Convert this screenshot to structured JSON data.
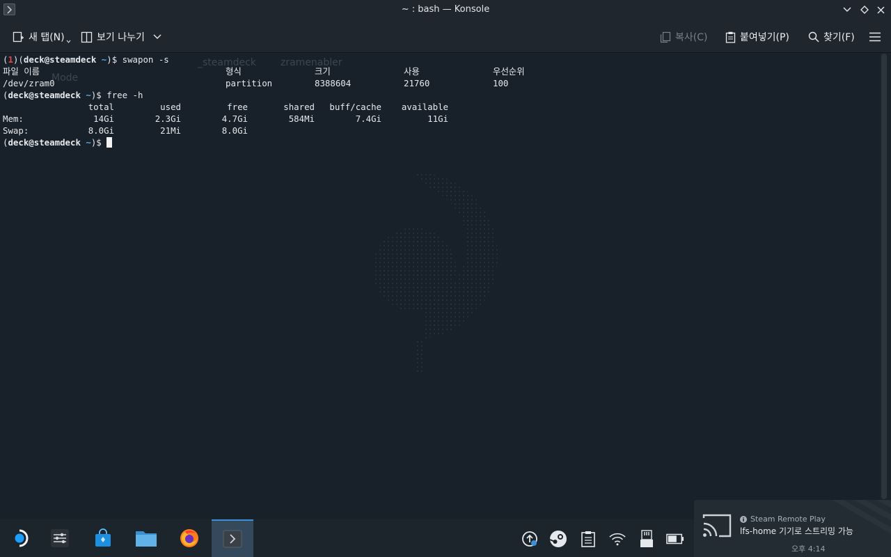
{
  "window": {
    "title": "~ : bash — Konsole"
  },
  "toolbar": {
    "new_tab": "새 탭(N)",
    "split_view": "보기 나누기",
    "copy": "복사(C)",
    "paste": "붙여넣기(P)",
    "find": "찾기(F)"
  },
  "terminal": {
    "ghost_texts": [
      "_steamdeck",
      "zramenabler",
      "Mode"
    ],
    "prompt_user": "deck@steamdeck",
    "prompt_dir": "~",
    "prev_status": "1",
    "cmd1": "swapon -s",
    "swapon_headers": [
      "파일 이름",
      "형식",
      "크기",
      "사용",
      "우선순위"
    ],
    "swapon_row": [
      "/dev/zram0",
      "partition",
      "8388604",
      "21760",
      "100"
    ],
    "cmd2": "free -h",
    "free_headers": [
      "total",
      "used",
      "free",
      "shared",
      "buff/cache",
      "available"
    ],
    "free_rows": [
      {
        "label": "Mem:",
        "total": "14Gi",
        "used": "2.3Gi",
        "free": "4.7Gi",
        "shared": "584Mi",
        "buff": "7.4Gi",
        "available": "11Gi"
      },
      {
        "label": "Swap:",
        "total": "8.0Gi",
        "used": "21Mi",
        "free": "8.0Gi"
      }
    ]
  },
  "notification": {
    "app": "Steam Remote Play",
    "body": "lfs-home 기기로 스트리밍 가능",
    "clock": "오후 4:14"
  },
  "taskbar": {
    "apps": [
      "steam-deck-menu",
      "system-settings",
      "discover-store",
      "dolphin-files",
      "firefox",
      "konsole"
    ],
    "tray": [
      "update-icon",
      "steam-icon",
      "clipboard-icon",
      "wifi-icon",
      "sd-card-icon",
      "battery-icon"
    ]
  },
  "colors": {
    "accent": "#3d8fd6",
    "prompt_user": "#e6e9ec",
    "prompt_dir": "#5aa7e6",
    "error_code": "#d94848"
  }
}
